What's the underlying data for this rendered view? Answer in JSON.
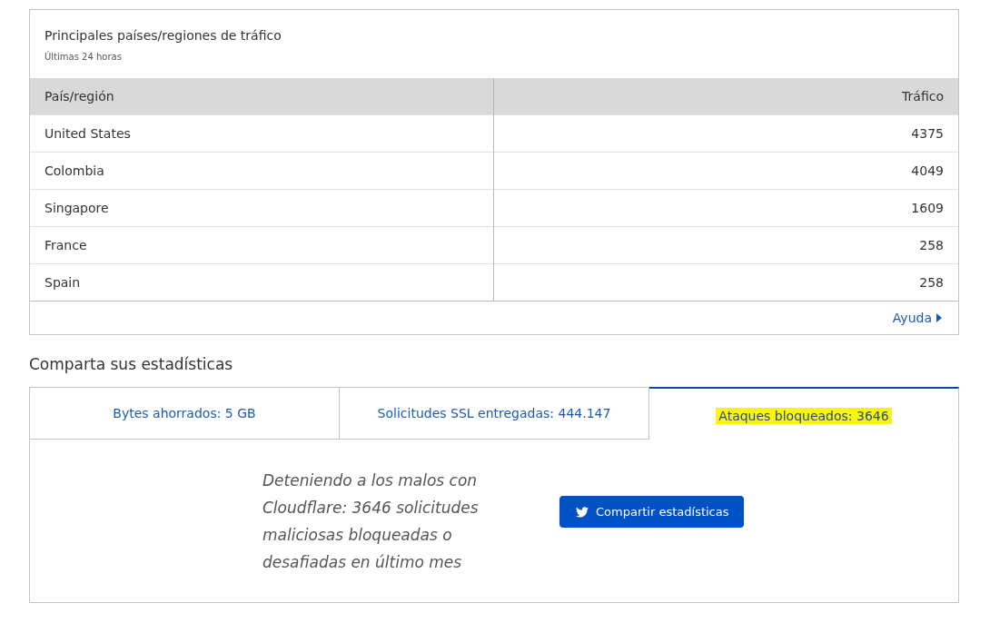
{
  "traffic_card": {
    "title": "Principales países/regiones de tráfico",
    "subtitle": "Últimas 24 horas",
    "table": {
      "columns": [
        "País/región",
        "Tráfico"
      ],
      "rows": [
        [
          "United States",
          "4375"
        ],
        [
          "Colombia",
          "4049"
        ],
        [
          "Singapore",
          "1609"
        ],
        [
          "France",
          "258"
        ],
        [
          "Spain",
          "258"
        ]
      ]
    },
    "help_link": "Ayuda"
  },
  "share": {
    "heading": "Comparta sus estadísticas",
    "tabs": [
      {
        "label": "Bytes ahorrados: 5 GB",
        "selected": false,
        "highlighted": false
      },
      {
        "label": "Solicitudes SSL entregadas: 444.147",
        "selected": false,
        "highlighted": false
      },
      {
        "label": "Ataques bloqueados: 3646",
        "selected": true,
        "highlighted": true
      }
    ],
    "message": "Deteniendo a los malos con Cloudflare: 3646 solicitudes maliciosas bloqueadas o desafiadas en último mes",
    "button": "Compartir estadísticas"
  }
}
